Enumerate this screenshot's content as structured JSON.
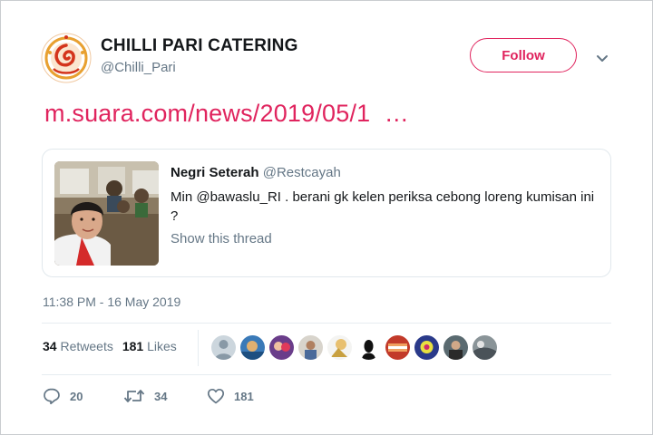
{
  "account": {
    "name": "CHILLI PARI CATERING",
    "handle": "@Chilli_Pari",
    "avatar_icon": "chilli-pari-logo",
    "brand_color": "#d4341c"
  },
  "follow_label": "Follow",
  "tweet": {
    "link_text": "m.suara.com/news/2019/05/1  …",
    "link_color": "#e0245e"
  },
  "quoted": {
    "name": "Negri Seterah",
    "handle": "@Restcayah",
    "text": "Min @bawaslu_RI . berani gk kelen periksa cebong loreng kumisan ini  ?",
    "show_thread": "Show this thread"
  },
  "timestamp": "11:38 PM - 16 May 2019",
  "stats": {
    "retweets_count": "34",
    "retweets_label": "Retweets",
    "likes_count": "181",
    "likes_label": "Likes"
  },
  "actions": {
    "replies": "20",
    "retweets": "34",
    "likes": "181"
  },
  "accent_color": "#e0245e"
}
